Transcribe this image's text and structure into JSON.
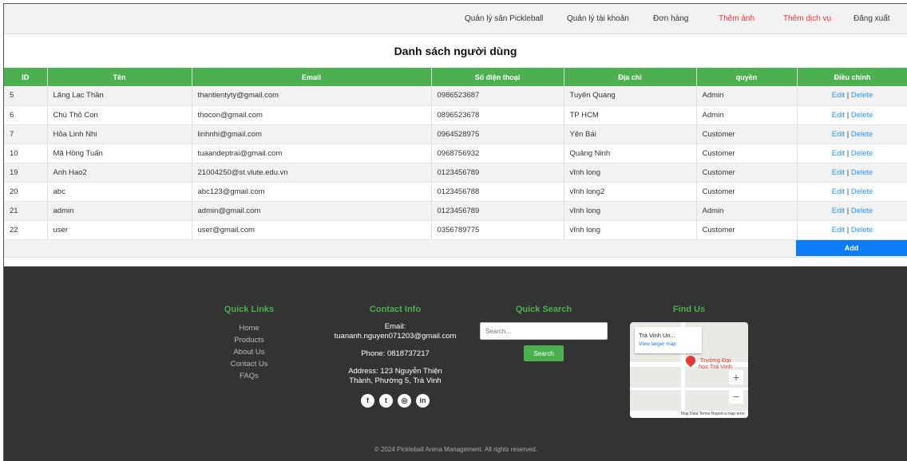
{
  "nav": {
    "items": [
      {
        "label": "Quản lý sân Pickleball",
        "accent": false
      },
      {
        "label": "Quản lý tài khoản",
        "accent": false
      },
      {
        "label": "Đơn hàng",
        "accent": false
      },
      {
        "label": "Thêm ảnh",
        "accent": true
      },
      {
        "label": "Thêm dịch vụ",
        "accent": true
      },
      {
        "label": "Đăng xuất",
        "accent": false
      }
    ]
  },
  "page": {
    "title": "Danh sách người dùng"
  },
  "table": {
    "headers": [
      "ID",
      "Tên",
      "Email",
      "Số điện thoại",
      "Địa chỉ",
      "quyền",
      "Điều chỉnh"
    ],
    "rows": [
      [
        "5",
        "Lăng Lạc Thần",
        "thantientyty@gmail.com",
        "0986523687",
        "Tuyên Quang",
        "Admin"
      ],
      [
        "6",
        "Chú Thỏ Con",
        "thocon@gmail.com",
        "0896523678",
        "TP HCM",
        "Admin"
      ],
      [
        "7",
        "Hỏa Linh Nhi",
        "linhnhi@gmail.com",
        "0964528975",
        "Yên Bái",
        "Customer"
      ],
      [
        "10",
        "Mã Hồng Tuấn",
        "tuaandeptrai@gmail.com",
        "0968756932",
        "Quảng Ninh",
        "Customer"
      ],
      [
        "19",
        "Anh Hao2",
        "21004250@st.vlute.edu.vn",
        "0123456789",
        "vĩnh long",
        "Customer"
      ],
      [
        "20",
        "abc",
        "abc123@gmail.com",
        "0123456788",
        "vĩnh long2",
        "Customer"
      ],
      [
        "21",
        "admin",
        "admin@gmail.com",
        "0123456789",
        "vĩnh long",
        "Admin"
      ],
      [
        "22",
        "user",
        "user@gmail.com",
        "0356789775",
        "vĩnh long",
        "Customer"
      ]
    ],
    "edit_label": "Edit",
    "separator": "|",
    "delete_label": "Delete",
    "add_label": "Add"
  },
  "footer": {
    "quick_links": {
      "title": "Quick Links",
      "items": [
        "Home",
        "Products",
        "About Us",
        "Contact Us",
        "FAQs"
      ]
    },
    "contact": {
      "title": "Contact Info",
      "email_label": "Email:",
      "email": "tuananh.nguyen071203@gmail.com",
      "phone": "Phone: 0818737217",
      "address_line1": "Address: 123 Nguyễn Thiện",
      "address_line2": "Thành, Phường 5, Trà Vinh",
      "social": [
        "facebook-icon",
        "twitter-icon",
        "instagram-icon",
        "linkedin-icon"
      ]
    },
    "search": {
      "title": "Quick Search",
      "placeholder": "Search...",
      "button": "Search"
    },
    "find_us": {
      "title": "Find Us",
      "map_place": "Trà Vinh Un...",
      "map_link": "View larger map",
      "map_label_line1": "Trường Đại",
      "map_label_line2": "học Trà Vinh",
      "map_footer": "Map Data  Terms  Report a map error"
    },
    "copyright": "© 2024 Pickleball Arena Management. All rights reserved."
  },
  "colors": {
    "green": "#4caf50",
    "blue": "#0b7cf5",
    "red": "#e53935",
    "footer_bg": "#333333"
  }
}
